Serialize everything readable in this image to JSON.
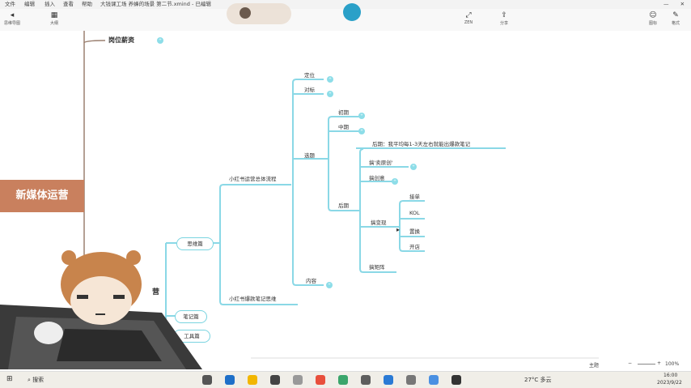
{
  "menu": [
    "文件",
    "编辑",
    "插入",
    "查看",
    "帮助"
  ],
  "window_title": "大钱课工场 养蜂的场景 第二节.xmind - 已编辑",
  "toolbar": {
    "left": [
      {
        "icon": "home-icon",
        "label": "思维导图"
      },
      {
        "icon": "grid-icon",
        "label": "大纲"
      }
    ],
    "right": [
      {
        "icon": "fullscreen-icon",
        "label": "ZEN"
      },
      {
        "icon": "share-icon",
        "label": "分享"
      },
      {
        "icon": "mark-icon",
        "label": "图标"
      },
      {
        "icon": "format-icon",
        "label": "格式"
      }
    ]
  },
  "map": {
    "root": "新媒体运营",
    "top_node": "岗位薪资",
    "pills": [
      "思维篇",
      "笔记篇",
      "工具篇"
    ],
    "main_branches": [
      "小红书运营总体流程",
      "小红书爆款笔记思维"
    ],
    "level2": [
      "定位",
      "对标",
      "选题",
      "内容"
    ],
    "xuanti_children": [
      "初期",
      "中期",
      "后期"
    ],
    "late_note": "后期：我平均每1-3天左右就能出爆款笔记",
    "houqi_children": [
      "搞'卖原创'",
      "搞创意",
      "搞变现",
      "搞矩阵"
    ],
    "bianxian_children": [
      "接单",
      "KOL",
      "置换",
      "开店"
    ]
  },
  "status": {
    "zoom": "100%",
    "mode": "主题"
  },
  "taskbar": {
    "search": "搜索",
    "weather": "27°C 多云",
    "time": "16:00",
    "date": "2023/9/22"
  }
}
